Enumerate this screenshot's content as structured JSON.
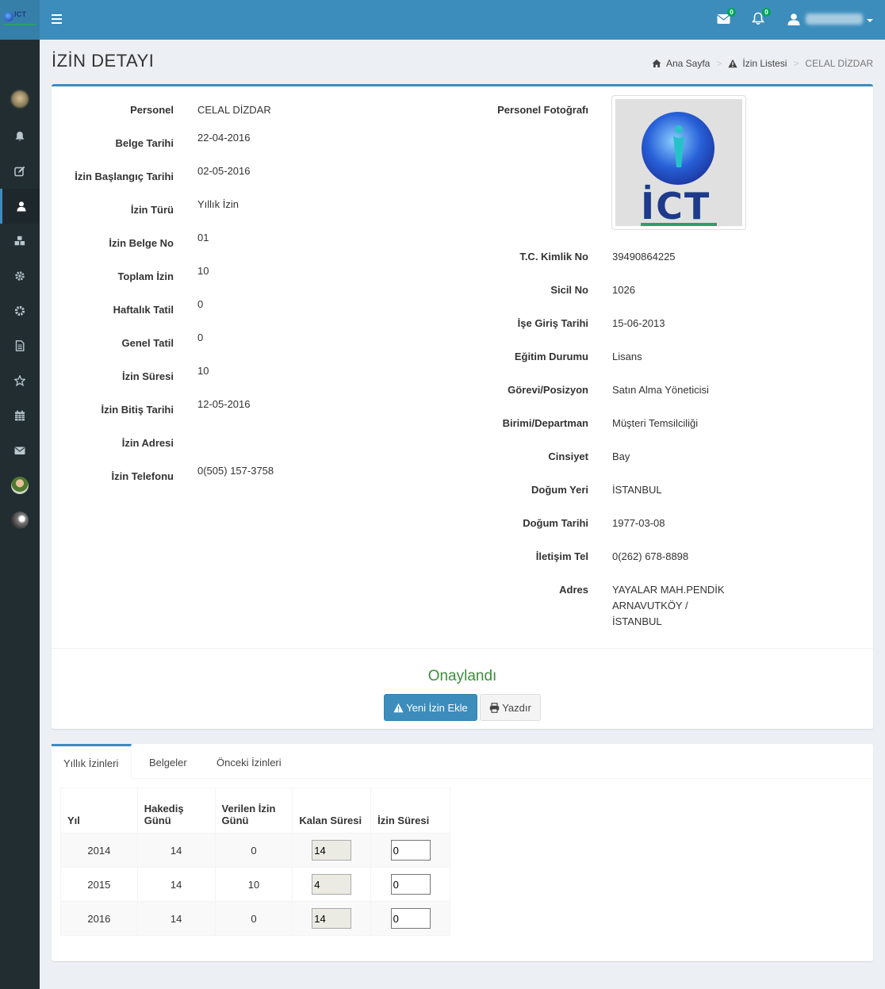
{
  "header": {
    "messages_count": "0",
    "notifications_count": "0"
  },
  "page": {
    "title": "İZİN DETAYI",
    "breadcrumb": {
      "home": "Ana Sayfa",
      "list": "İzin Listesi",
      "current": "CELAL DİZDAR"
    }
  },
  "leave_fields": [
    {
      "label": "Personel",
      "value": "CELAL DİZDAR"
    },
    {
      "label": "Belge Tarihi",
      "value": "22-04-2016"
    },
    {
      "label": "İzin Başlangıç Tarihi",
      "value": "02-05-2016"
    },
    {
      "label": "İzin Türü",
      "value": "Yıllık İzin"
    },
    {
      "label": "İzin Belge No",
      "value": "01"
    },
    {
      "label": "Toplam İzin",
      "value": "10"
    },
    {
      "label": "Haftalık Tatil",
      "value": "0"
    },
    {
      "label": "Genel Tatil",
      "value": "0"
    },
    {
      "label": "İzin Süresi",
      "value": "10"
    },
    {
      "label": "İzin Bitiş Tarihi",
      "value": "12-05-2016"
    },
    {
      "label": "İzin Adresi",
      "value": ""
    },
    {
      "label": "İzin Telefonu",
      "value": "0(505) 157-3758"
    }
  ],
  "photo": {
    "label": "Personel Fotoğrafı",
    "logo_text": "İCT"
  },
  "person_fields": [
    {
      "label": "T.C. Kimlik No",
      "value": "39490864225"
    },
    {
      "label": "Sicil No",
      "value": "1026"
    },
    {
      "label": "İşe Giriş Tarihi",
      "value": "15-06-2013"
    },
    {
      "label": "Eğitim Durumu",
      "value": "Lisans"
    },
    {
      "label": "Görevi/Posizyon",
      "value": "Satın Alma Yöneticisi"
    },
    {
      "label": "Birimi/Departman",
      "value": "Müşteri Temsilciliği"
    },
    {
      "label": "Cinsiyet",
      "value": "Bay"
    },
    {
      "label": "Doğum Yeri",
      "value": "İSTANBUL"
    },
    {
      "label": "Doğum Tarihi",
      "value": "1977-03-08"
    },
    {
      "label": "İletişim Tel",
      "value": "0(262) 678-8898"
    },
    {
      "label": "Adres",
      "lines": [
        "YAYALAR MAH.PENDİK",
        "ARNAVUTKÖY /",
        "İSTANBUL"
      ]
    }
  ],
  "status_text": "Onaylandı",
  "buttons": {
    "new_leave": "Yeni İzin Ekle",
    "print": "Yazdır"
  },
  "tabs": [
    "Yıllık İzinleri",
    "Belgeler",
    "Önceki İzinleri"
  ],
  "table": {
    "headers": [
      "Yıl",
      "Hakediş Günü",
      "Verilen İzin Günü",
      "Kalan Süresi",
      "İzin Süresi"
    ],
    "rows": [
      {
        "year": "2014",
        "earned": "14",
        "given": "0",
        "remaining": "14",
        "duration": "0"
      },
      {
        "year": "2015",
        "earned": "14",
        "given": "10",
        "remaining": "4",
        "duration": "0"
      },
      {
        "year": "2016",
        "earned": "14",
        "given": "0",
        "remaining": "14",
        "duration": "0"
      }
    ]
  },
  "colors": {
    "primary": "#3c8dbc",
    "sidebar": "#222d32",
    "success_text": "#3c8d3c",
    "badge": "#00a65a"
  }
}
